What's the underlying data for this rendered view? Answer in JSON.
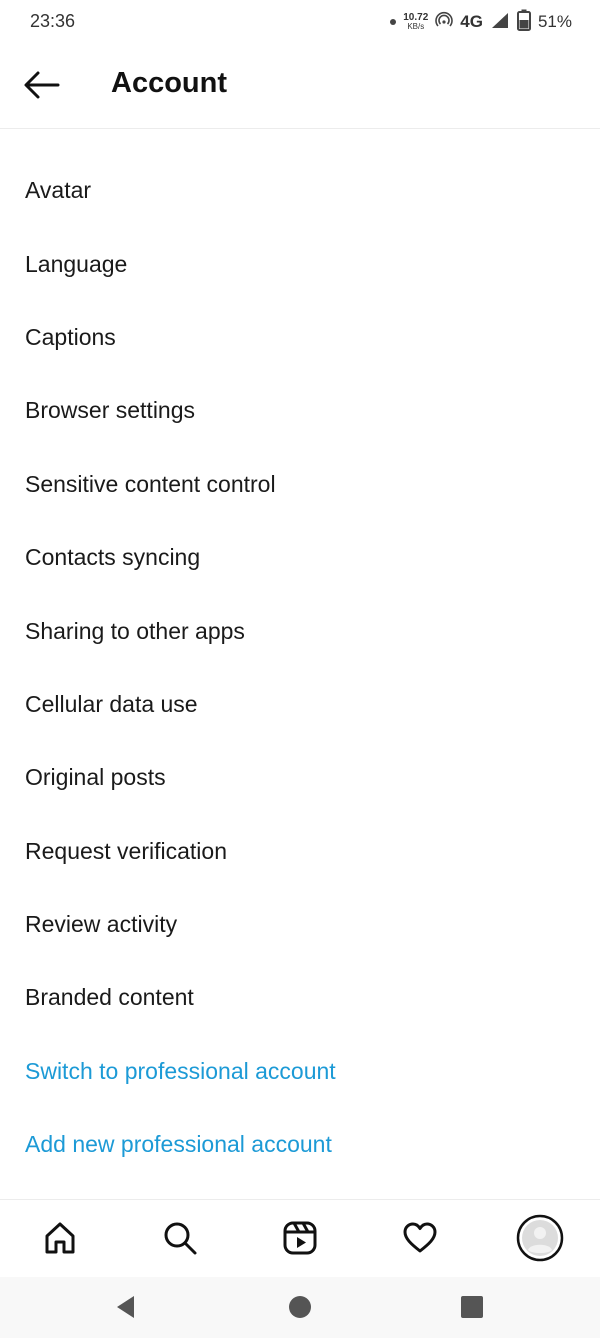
{
  "status_bar": {
    "time": "23:36",
    "net_speed_value": "10.72",
    "net_speed_unit": "KB/s",
    "network_type": "4G",
    "battery_percent": "51%"
  },
  "header": {
    "title": "Account"
  },
  "settings": {
    "items": [
      {
        "label": "Avatar"
      },
      {
        "label": "Language"
      },
      {
        "label": "Captions"
      },
      {
        "label": "Browser settings"
      },
      {
        "label": "Sensitive content control"
      },
      {
        "label": "Contacts syncing"
      },
      {
        "label": "Sharing to other apps"
      },
      {
        "label": "Cellular data use"
      },
      {
        "label": "Original posts"
      },
      {
        "label": "Request verification"
      },
      {
        "label": "Review activity"
      },
      {
        "label": "Branded content"
      }
    ],
    "links": [
      {
        "label": "Switch to professional account"
      },
      {
        "label": "Add new professional account"
      }
    ]
  },
  "colors": {
    "link": "#1c9ad6",
    "text": "#1a1a1a",
    "divider": "#ececec"
  },
  "bottom_nav": {
    "icons": [
      "home-icon",
      "search-icon",
      "reels-icon",
      "heart-icon",
      "profile-avatar-icon"
    ]
  },
  "system_nav": {
    "icons": [
      "back-triangle-icon",
      "home-circle-icon",
      "recents-square-icon"
    ]
  }
}
